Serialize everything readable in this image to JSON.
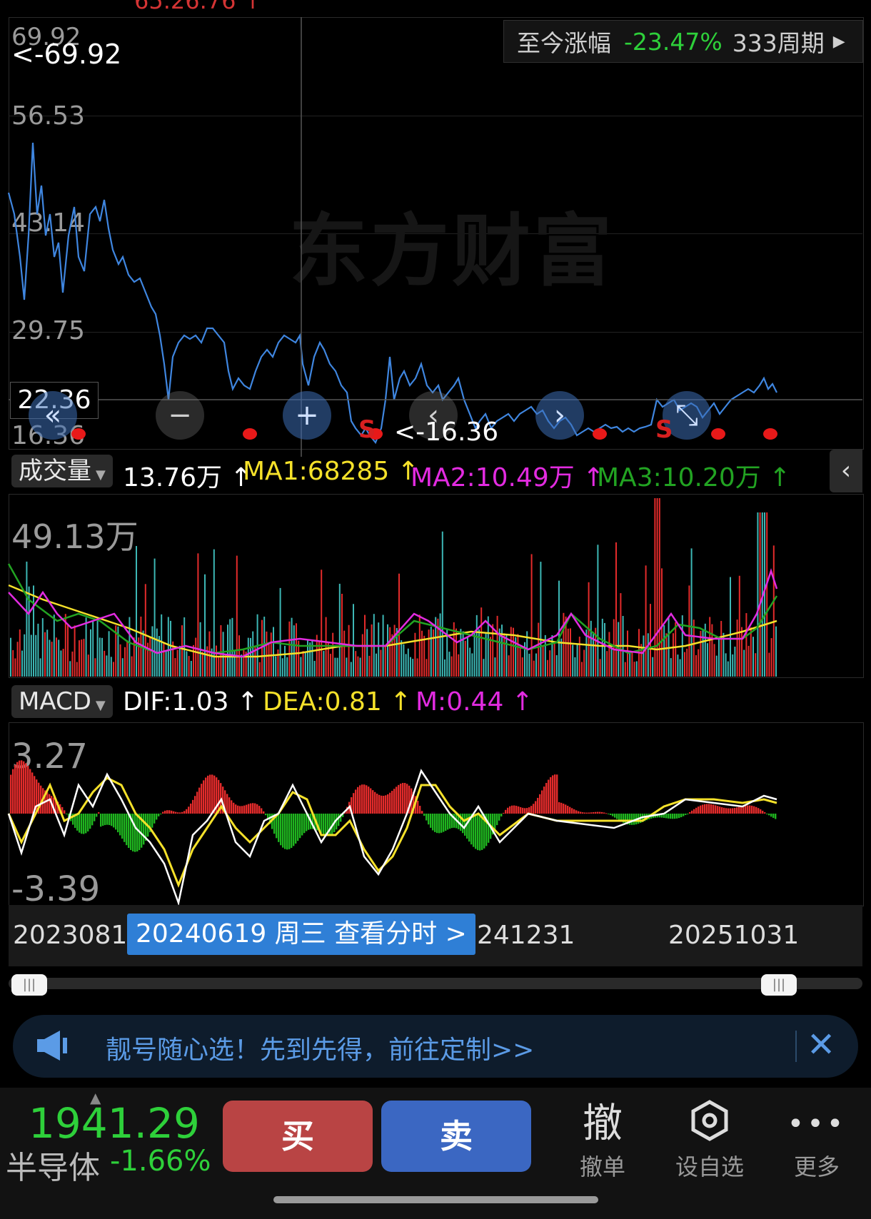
{
  "top_price_partial": "65.26.76 ↑",
  "price_chart": {
    "y_ticks": [
      "69.92",
      "56.53",
      "43.14",
      "29.75",
      "16.36"
    ],
    "max_marker": "<-69.92",
    "min_marker": "<-16.36",
    "crosshair_value": "22.36",
    "watermark": "东方财富",
    "period_box": {
      "label": "至今涨幅",
      "change": "-23.47%",
      "period": "333周期"
    },
    "sell_marks": [
      "S",
      "S"
    ]
  },
  "controls": {
    "prev_icon": "double-left-icon",
    "zoom_out": "−",
    "zoom_in": "+",
    "left_icon": "chevron-left-icon",
    "right_icon": "chevron-right-icon",
    "expand_icon": "expand-icon"
  },
  "volume": {
    "selector_label": "成交量",
    "current": "13.76万 ↑",
    "ma1": "MA1:68285 ↑",
    "ma2": "MA2:10.49万 ↑",
    "ma3": "MA3:10.20万 ↑",
    "max_label": "49.13万",
    "collapse_icon": "chevron-left-icon"
  },
  "macd": {
    "selector_label": "MACD",
    "dif": "DIF:1.03 ↑",
    "dea": "DEA:0.81 ↑",
    "m": "M:0.44 ↑",
    "top_label": "3.27",
    "bottom_label": "-3.39"
  },
  "x_axis": {
    "start": "20230810",
    "mid_partial": "241231",
    "end": "20251031",
    "hover_chip": "20240619 周三 查看分时 >"
  },
  "banner": {
    "icon": "megaphone-icon",
    "text": "靓号随心选！先到先得，前往定制>>",
    "close_icon": "close-icon"
  },
  "bottom": {
    "index_value": "1941.29",
    "index_name": "半导体",
    "index_change": "-1.66%",
    "buy_label": "买",
    "sell_label": "卖",
    "cancel_icon_char": "撤",
    "cancel_label": "撤单",
    "watch_label": "设自选",
    "more_label": "更多"
  },
  "colors": {
    "up": "#e32b2b",
    "down": "#1fb51f",
    "price_line": "#3f86e0",
    "ma_yellow": "#f5e12a",
    "ma_magenta": "#e22be0",
    "ma_green": "#22a322",
    "buy_btn": "#b94444",
    "sell_btn": "#3b67c2"
  }
}
